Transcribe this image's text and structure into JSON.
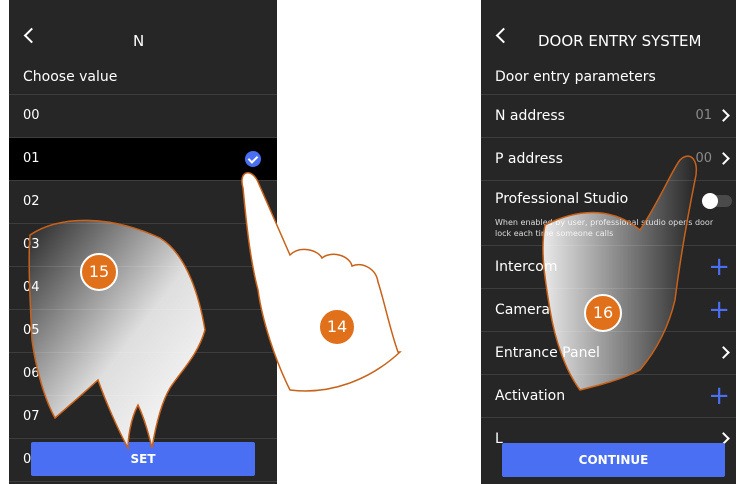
{
  "left_screen": {
    "header_title": "N",
    "subtitle": "Choose value",
    "options": [
      "00",
      "01",
      "02",
      "03",
      "04",
      "05",
      "06",
      "07",
      "0"
    ],
    "selected": "01",
    "set_label": "SET"
  },
  "right_screen": {
    "header_title": "DOOR ENTRY SYSTEM",
    "subtitle": "Door entry parameters",
    "n_address_label": "N address",
    "n_address_value": "01",
    "p_address_label": "P address",
    "p_address_value": "00",
    "pro_studio_label": "Professional Studio",
    "pro_studio_desc": "When enabled by user, professional studio opens door lock each time someone calls",
    "intercom_label": "Intercom",
    "camera_label": "Camera",
    "entrance_panel_label": "Entrance Panel",
    "activation_label": "Activation",
    "last_row_label": "L",
    "continue_label": "CONTINUE"
  },
  "steps": {
    "step14": "14",
    "step15": "15",
    "step16": "16"
  },
  "colors": {
    "accent": "#4a6ff2",
    "badge": "#e0701a",
    "screen_bg": "#262626",
    "hand_outline": "#c8621a"
  }
}
